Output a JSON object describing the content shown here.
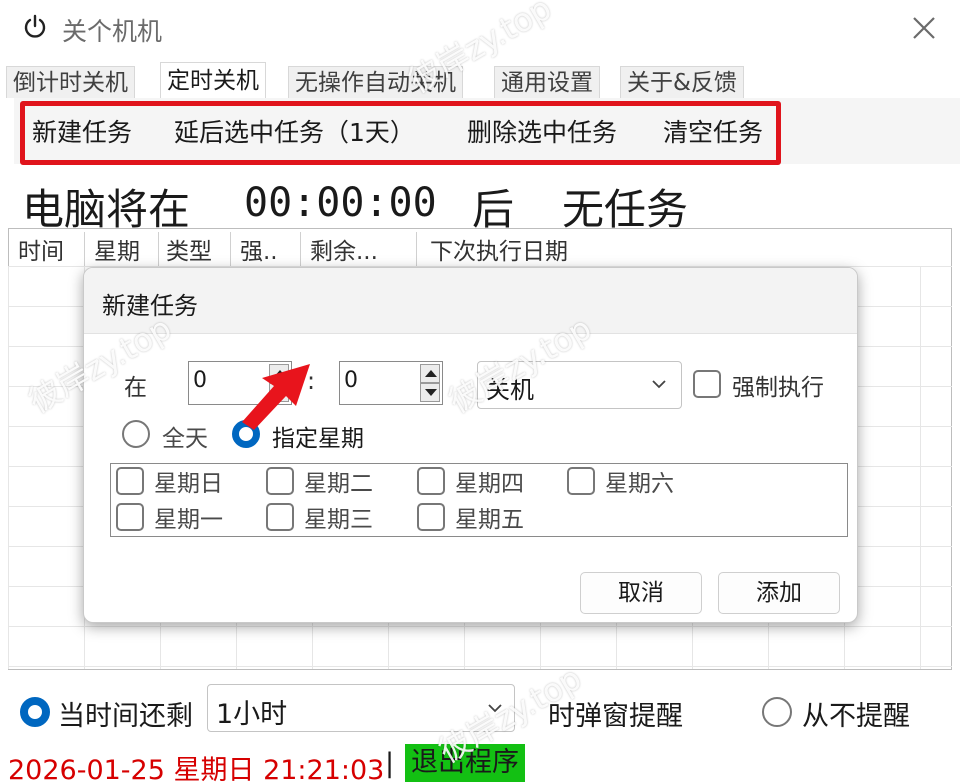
{
  "window": {
    "title": "关个机机"
  },
  "tabs": [
    {
      "label": "倒计时关机"
    },
    {
      "label": "定时关机"
    },
    {
      "label": "无操作自动关机"
    },
    {
      "label": "通用设置"
    },
    {
      "label": "关于&反馈"
    }
  ],
  "toolbar": {
    "new_task": "新建任务",
    "delay_task": "延后选中任务（1天）",
    "delete_task": "删除选中任务",
    "clear_tasks": "清空任务",
    "highlight_color": "#e0141c"
  },
  "status": {
    "prefix": "电脑将在",
    "time": "00:00:00",
    "after": "后",
    "state": "无任务"
  },
  "list": {
    "columns": [
      "时间",
      "星期",
      "类型",
      "强..",
      "剩余...",
      "下次执行日期"
    ]
  },
  "dialog": {
    "title": "新建任务",
    "at_label": "在",
    "hour": "0",
    "colon": ":",
    "minute": "0",
    "action": "关机",
    "force_label": "强制执行",
    "radio_all_day": "全天",
    "radio_weekdays": "指定星期",
    "weekdays": [
      "星期日",
      "星期一",
      "星期二",
      "星期三",
      "星期四",
      "星期五",
      "星期六"
    ],
    "cancel": "取消",
    "add": "添加"
  },
  "bottom": {
    "remind_prefix": "当时间还剩",
    "remind_value": "1小时",
    "remind_suffix": "时弹窗提醒",
    "never_remind": "从不提醒",
    "clock": "2026-01-25 星期日 21:21:03",
    "separator": "|",
    "exit": "退出程序",
    "exit_color": "#13c013"
  },
  "watermark": "彼岸zy.top",
  "accent_color": "#0067c0"
}
